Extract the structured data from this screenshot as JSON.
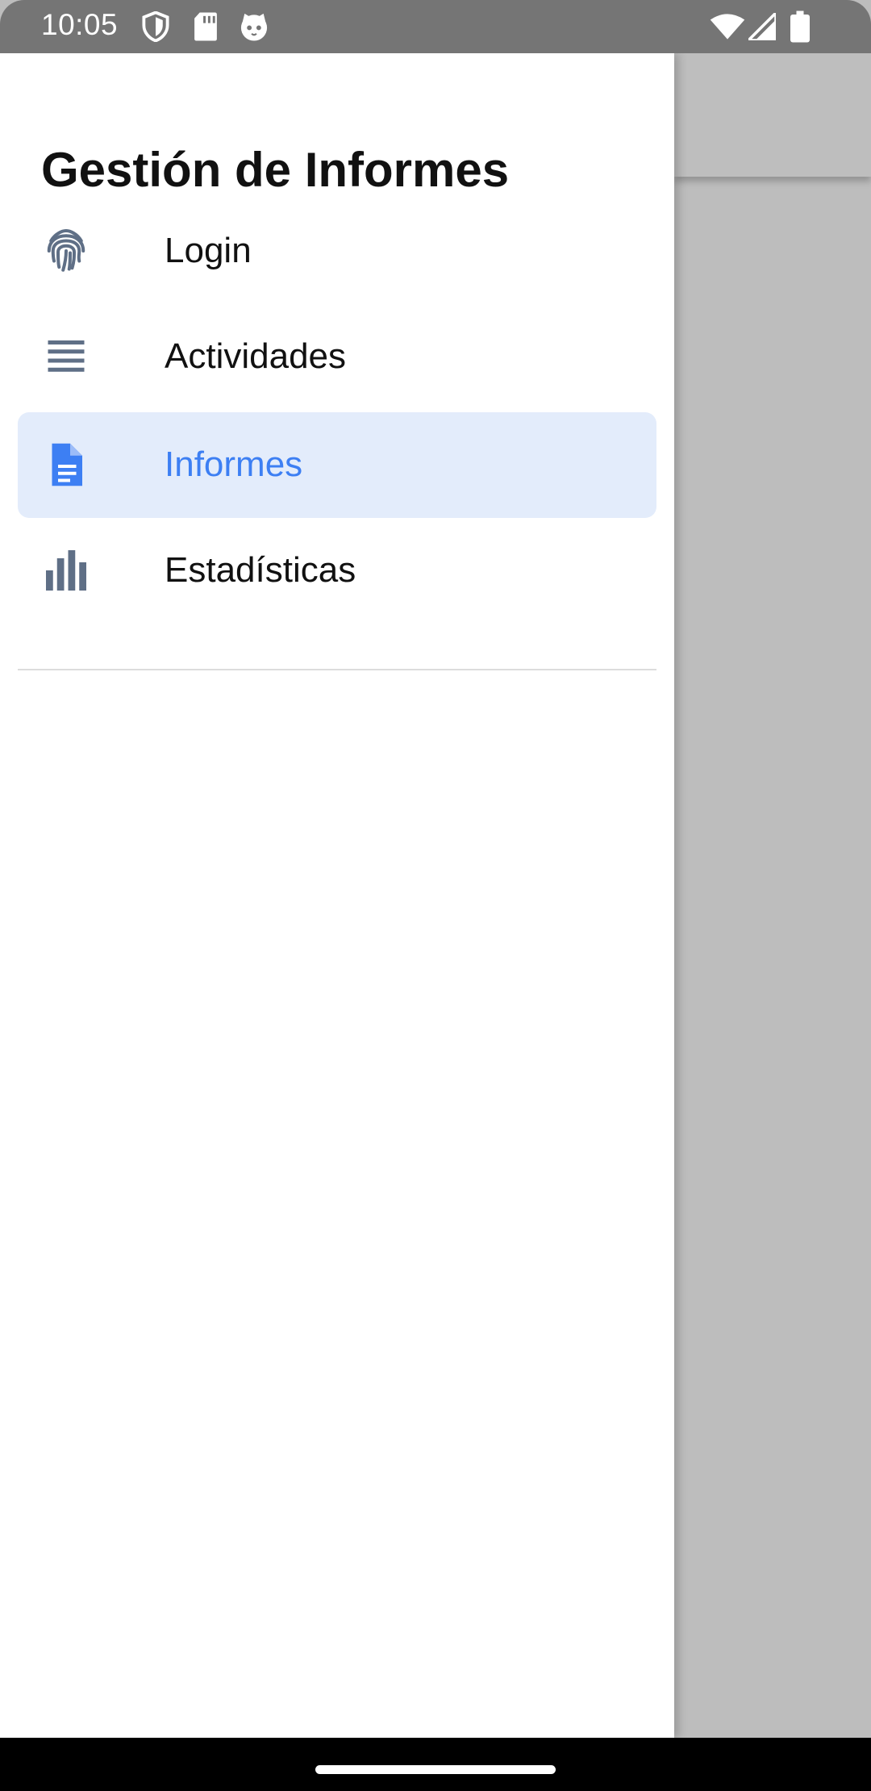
{
  "status_bar": {
    "time": "10:05",
    "left_icons": [
      "shield-icon",
      "sd-card-icon",
      "cat-face-icon"
    ],
    "right_icons": [
      "wifi-icon",
      "cellular-signal-icon",
      "battery-icon"
    ]
  },
  "drawer": {
    "title": "Gestión de Informes",
    "items": [
      {
        "label": "Login",
        "icon": "fingerprint-icon",
        "active": false
      },
      {
        "label": "Actividades",
        "icon": "list-icon",
        "active": false
      },
      {
        "label": "Informes",
        "icon": "document-icon",
        "active": true
      },
      {
        "label": "Estadísticas",
        "icon": "bar-chart-icon",
        "active": false
      }
    ]
  },
  "colors": {
    "accent": "#3d7ff3",
    "active_background": "#e3ecfb",
    "icon_gray": "#5f6f86",
    "status_bar": "#757575",
    "scrim": "#bdbdbd"
  }
}
